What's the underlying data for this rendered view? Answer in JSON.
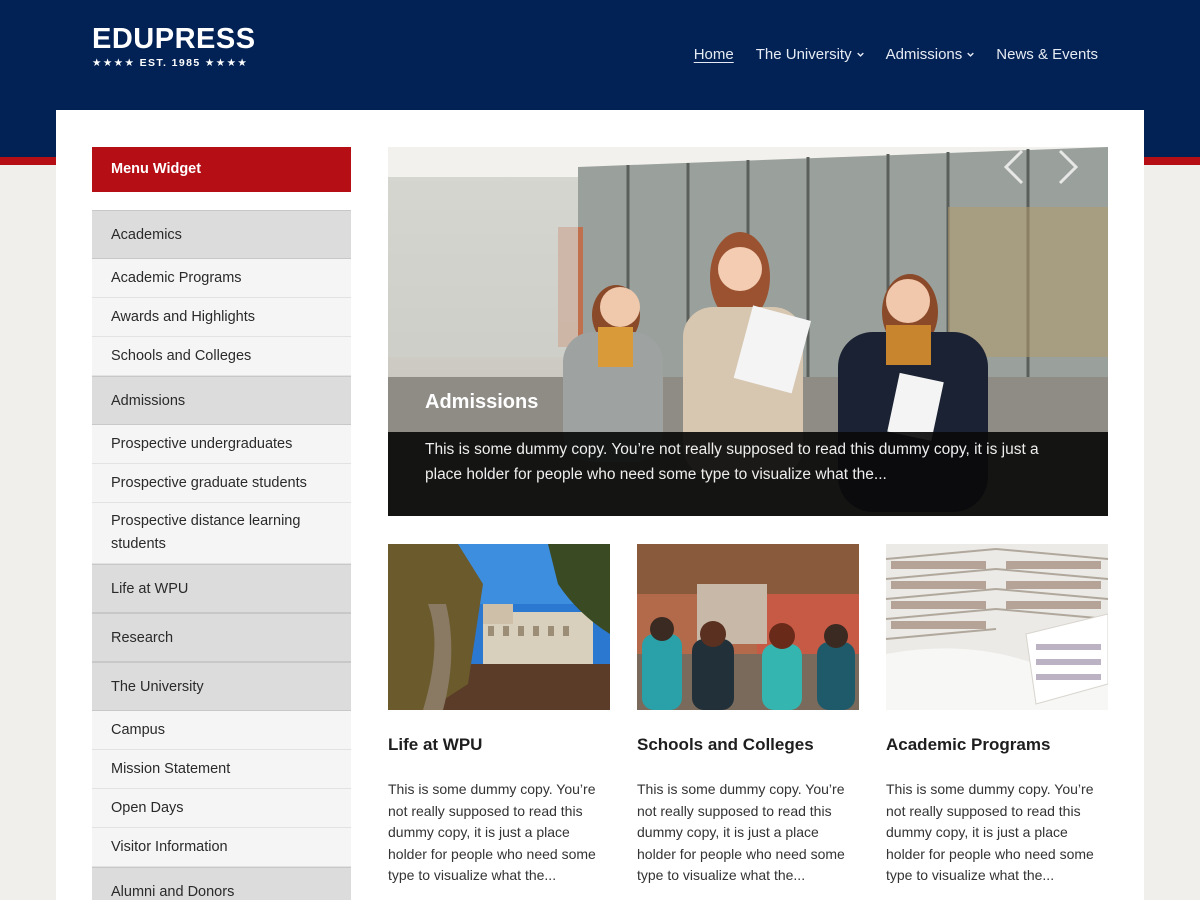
{
  "brand": {
    "name": "EDUPRESS",
    "tagline": "★★★★  EST. 1985  ★★★★"
  },
  "nav": {
    "items": [
      {
        "label": "Home",
        "active": true,
        "dropdown": false
      },
      {
        "label": "The University",
        "active": false,
        "dropdown": true
      },
      {
        "label": "Admissions",
        "active": false,
        "dropdown": true
      },
      {
        "label": "News & Events",
        "active": false,
        "dropdown": false
      }
    ]
  },
  "sidebar": {
    "title": "Menu Widget",
    "items": [
      {
        "label": "Academics",
        "type": "section"
      },
      {
        "label": "Academic Programs",
        "type": "sub"
      },
      {
        "label": "Awards and Highlights",
        "type": "sub"
      },
      {
        "label": "Schools and Colleges",
        "type": "sub"
      },
      {
        "label": "Admissions",
        "type": "section"
      },
      {
        "label": "Prospective undergraduates",
        "type": "sub"
      },
      {
        "label": "Prospective graduate students",
        "type": "sub"
      },
      {
        "label": "Prospective distance learning students",
        "type": "sub-tall"
      },
      {
        "label": "Life at WPU",
        "type": "section"
      },
      {
        "label": "Research",
        "type": "section"
      },
      {
        "label": "The University",
        "type": "section"
      },
      {
        "label": "Campus",
        "type": "sub"
      },
      {
        "label": "Mission Statement",
        "type": "sub"
      },
      {
        "label": "Open Days",
        "type": "sub"
      },
      {
        "label": "Visitor Information",
        "type": "sub"
      },
      {
        "label": "Alumni and Donors",
        "type": "section"
      }
    ]
  },
  "hero": {
    "title": "Admissions",
    "text": "This is some dummy copy. You’re not really supposed to read this dummy copy, it is just a place holder for people who need some type to visualize what the...",
    "prev_icon": "chevron-left-icon",
    "next_icon": "chevron-right-icon"
  },
  "posts": [
    {
      "title": "Life at WPU",
      "text": "This is some dummy copy. You’re not really supposed to read this dummy copy, it is just a place holder for people who need some type to visualize what the..."
    },
    {
      "title": "Schools and Colleges",
      "text": "This is some dummy copy. You’re not really supposed to read this dummy copy, it is just a place holder for people who need some type to visualize what the..."
    },
    {
      "title": "Academic Programs",
      "text": "This is some dummy copy. You’re not really supposed to read this dummy copy, it is just a place holder for people who need some type to visualize what the..."
    }
  ],
  "colors": {
    "navy": "#022255",
    "red": "#b50e14",
    "section_gray": "#dcdcdc"
  }
}
